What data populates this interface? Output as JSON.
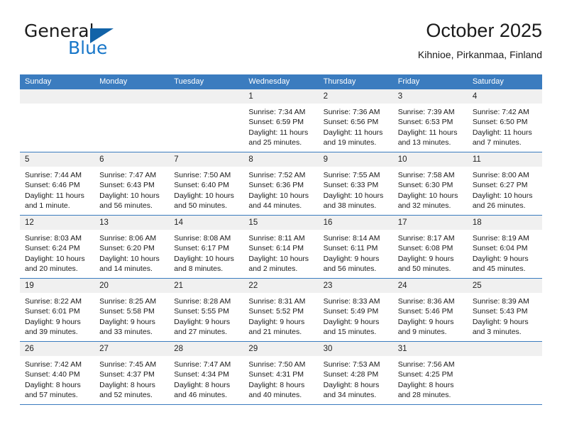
{
  "brand": {
    "line1": "General",
    "line2": "Blue",
    "triangle_color": "#1263a8",
    "blue_color": "#1877c9"
  },
  "header": {
    "title": "October 2025",
    "subtitle": "Kihnioe, Pirkanmaa, Finland"
  },
  "theme": {
    "header_bg": "#3b7cbf",
    "header_text": "#ffffff",
    "day_band_bg": "#f0f0f0",
    "row_border": "#3b7cbf"
  },
  "weekdays": [
    "Sunday",
    "Monday",
    "Tuesday",
    "Wednesday",
    "Thursday",
    "Friday",
    "Saturday"
  ],
  "weeks": [
    [
      {
        "day": "",
        "sunrise": "",
        "sunset": "",
        "daylight_1": "",
        "daylight_2": ""
      },
      {
        "day": "",
        "sunrise": "",
        "sunset": "",
        "daylight_1": "",
        "daylight_2": ""
      },
      {
        "day": "",
        "sunrise": "",
        "sunset": "",
        "daylight_1": "",
        "daylight_2": ""
      },
      {
        "day": "1",
        "sunrise": "Sunrise: 7:34 AM",
        "sunset": "Sunset: 6:59 PM",
        "daylight_1": "Daylight: 11 hours",
        "daylight_2": "and 25 minutes."
      },
      {
        "day": "2",
        "sunrise": "Sunrise: 7:36 AM",
        "sunset": "Sunset: 6:56 PM",
        "daylight_1": "Daylight: 11 hours",
        "daylight_2": "and 19 minutes."
      },
      {
        "day": "3",
        "sunrise": "Sunrise: 7:39 AM",
        "sunset": "Sunset: 6:53 PM",
        "daylight_1": "Daylight: 11 hours",
        "daylight_2": "and 13 minutes."
      },
      {
        "day": "4",
        "sunrise": "Sunrise: 7:42 AM",
        "sunset": "Sunset: 6:50 PM",
        "daylight_1": "Daylight: 11 hours",
        "daylight_2": "and 7 minutes."
      }
    ],
    [
      {
        "day": "5",
        "sunrise": "Sunrise: 7:44 AM",
        "sunset": "Sunset: 6:46 PM",
        "daylight_1": "Daylight: 11 hours",
        "daylight_2": "and 1 minute."
      },
      {
        "day": "6",
        "sunrise": "Sunrise: 7:47 AM",
        "sunset": "Sunset: 6:43 PM",
        "daylight_1": "Daylight: 10 hours",
        "daylight_2": "and 56 minutes."
      },
      {
        "day": "7",
        "sunrise": "Sunrise: 7:50 AM",
        "sunset": "Sunset: 6:40 PM",
        "daylight_1": "Daylight: 10 hours",
        "daylight_2": "and 50 minutes."
      },
      {
        "day": "8",
        "sunrise": "Sunrise: 7:52 AM",
        "sunset": "Sunset: 6:36 PM",
        "daylight_1": "Daylight: 10 hours",
        "daylight_2": "and 44 minutes."
      },
      {
        "day": "9",
        "sunrise": "Sunrise: 7:55 AM",
        "sunset": "Sunset: 6:33 PM",
        "daylight_1": "Daylight: 10 hours",
        "daylight_2": "and 38 minutes."
      },
      {
        "day": "10",
        "sunrise": "Sunrise: 7:58 AM",
        "sunset": "Sunset: 6:30 PM",
        "daylight_1": "Daylight: 10 hours",
        "daylight_2": "and 32 minutes."
      },
      {
        "day": "11",
        "sunrise": "Sunrise: 8:00 AM",
        "sunset": "Sunset: 6:27 PM",
        "daylight_1": "Daylight: 10 hours",
        "daylight_2": "and 26 minutes."
      }
    ],
    [
      {
        "day": "12",
        "sunrise": "Sunrise: 8:03 AM",
        "sunset": "Sunset: 6:24 PM",
        "daylight_1": "Daylight: 10 hours",
        "daylight_2": "and 20 minutes."
      },
      {
        "day": "13",
        "sunrise": "Sunrise: 8:06 AM",
        "sunset": "Sunset: 6:20 PM",
        "daylight_1": "Daylight: 10 hours",
        "daylight_2": "and 14 minutes."
      },
      {
        "day": "14",
        "sunrise": "Sunrise: 8:08 AM",
        "sunset": "Sunset: 6:17 PM",
        "daylight_1": "Daylight: 10 hours",
        "daylight_2": "and 8 minutes."
      },
      {
        "day": "15",
        "sunrise": "Sunrise: 8:11 AM",
        "sunset": "Sunset: 6:14 PM",
        "daylight_1": "Daylight: 10 hours",
        "daylight_2": "and 2 minutes."
      },
      {
        "day": "16",
        "sunrise": "Sunrise: 8:14 AM",
        "sunset": "Sunset: 6:11 PM",
        "daylight_1": "Daylight: 9 hours",
        "daylight_2": "and 56 minutes."
      },
      {
        "day": "17",
        "sunrise": "Sunrise: 8:17 AM",
        "sunset": "Sunset: 6:08 PM",
        "daylight_1": "Daylight: 9 hours",
        "daylight_2": "and 50 minutes."
      },
      {
        "day": "18",
        "sunrise": "Sunrise: 8:19 AM",
        "sunset": "Sunset: 6:04 PM",
        "daylight_1": "Daylight: 9 hours",
        "daylight_2": "and 45 minutes."
      }
    ],
    [
      {
        "day": "19",
        "sunrise": "Sunrise: 8:22 AM",
        "sunset": "Sunset: 6:01 PM",
        "daylight_1": "Daylight: 9 hours",
        "daylight_2": "and 39 minutes."
      },
      {
        "day": "20",
        "sunrise": "Sunrise: 8:25 AM",
        "sunset": "Sunset: 5:58 PM",
        "daylight_1": "Daylight: 9 hours",
        "daylight_2": "and 33 minutes."
      },
      {
        "day": "21",
        "sunrise": "Sunrise: 8:28 AM",
        "sunset": "Sunset: 5:55 PM",
        "daylight_1": "Daylight: 9 hours",
        "daylight_2": "and 27 minutes."
      },
      {
        "day": "22",
        "sunrise": "Sunrise: 8:31 AM",
        "sunset": "Sunset: 5:52 PM",
        "daylight_1": "Daylight: 9 hours",
        "daylight_2": "and 21 minutes."
      },
      {
        "day": "23",
        "sunrise": "Sunrise: 8:33 AM",
        "sunset": "Sunset: 5:49 PM",
        "daylight_1": "Daylight: 9 hours",
        "daylight_2": "and 15 minutes."
      },
      {
        "day": "24",
        "sunrise": "Sunrise: 8:36 AM",
        "sunset": "Sunset: 5:46 PM",
        "daylight_1": "Daylight: 9 hours",
        "daylight_2": "and 9 minutes."
      },
      {
        "day": "25",
        "sunrise": "Sunrise: 8:39 AM",
        "sunset": "Sunset: 5:43 PM",
        "daylight_1": "Daylight: 9 hours",
        "daylight_2": "and 3 minutes."
      }
    ],
    [
      {
        "day": "26",
        "sunrise": "Sunrise: 7:42 AM",
        "sunset": "Sunset: 4:40 PM",
        "daylight_1": "Daylight: 8 hours",
        "daylight_2": "and 57 minutes."
      },
      {
        "day": "27",
        "sunrise": "Sunrise: 7:45 AM",
        "sunset": "Sunset: 4:37 PM",
        "daylight_1": "Daylight: 8 hours",
        "daylight_2": "and 52 minutes."
      },
      {
        "day": "28",
        "sunrise": "Sunrise: 7:47 AM",
        "sunset": "Sunset: 4:34 PM",
        "daylight_1": "Daylight: 8 hours",
        "daylight_2": "and 46 minutes."
      },
      {
        "day": "29",
        "sunrise": "Sunrise: 7:50 AM",
        "sunset": "Sunset: 4:31 PM",
        "daylight_1": "Daylight: 8 hours",
        "daylight_2": "and 40 minutes."
      },
      {
        "day": "30",
        "sunrise": "Sunrise: 7:53 AM",
        "sunset": "Sunset: 4:28 PM",
        "daylight_1": "Daylight: 8 hours",
        "daylight_2": "and 34 minutes."
      },
      {
        "day": "31",
        "sunrise": "Sunrise: 7:56 AM",
        "sunset": "Sunset: 4:25 PM",
        "daylight_1": "Daylight: 8 hours",
        "daylight_2": "and 28 minutes."
      },
      {
        "day": "",
        "sunrise": "",
        "sunset": "",
        "daylight_1": "",
        "daylight_2": ""
      }
    ]
  ]
}
